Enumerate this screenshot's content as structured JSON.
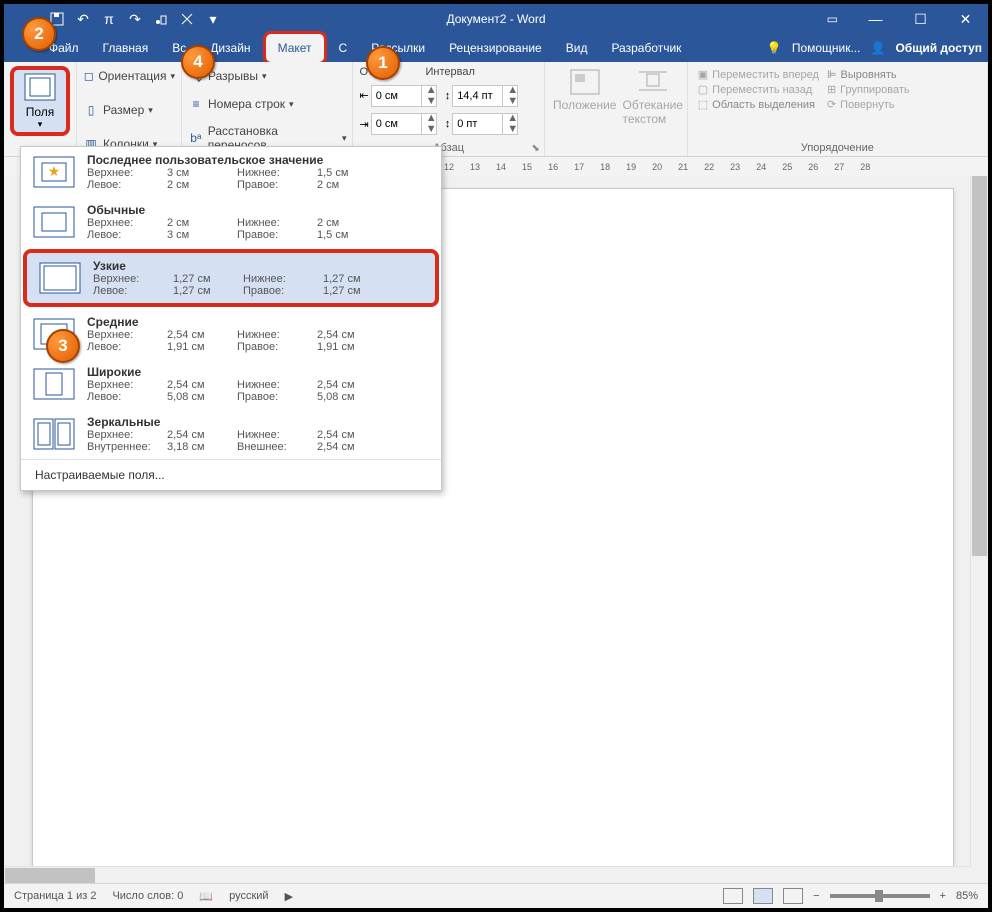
{
  "title": "Документ2 - Word",
  "qat": {
    "arrow": "▾"
  },
  "win": {
    "min": "—",
    "max": "☐",
    "close": "✕"
  },
  "tabs": [
    "Файл",
    "Главная",
    "Вс",
    "Дизайн",
    "Макет",
    "С",
    "Рассылки",
    "Рецензирование",
    "Вид",
    "Разработчик"
  ],
  "activeTab": 4,
  "help": "Помощник...",
  "share": "Общий доступ",
  "ribbon": {
    "margins_btn": "Поля",
    "orient": "Ориентация",
    "size": "Размер",
    "columns": "Колонки",
    "breaks": "Разрывы",
    "lines": "Номера строк",
    "hyphen": "Расстановка переносов",
    "indent_lbl": "Отступ",
    "spacing_lbl": "Интервал",
    "indL": "0 см",
    "indR": "0 см",
    "spB": "14,4 пт",
    "spA": "0 пт",
    "paragraph": "Абзац",
    "position": "Положение",
    "wrap": "Обтекание текстом",
    "fwd": "Переместить вперед",
    "back": "Переместить назад",
    "pane": "Область выделения",
    "align": "Выровнять",
    "group": "Группировать",
    "rotate": "Повернуть",
    "arrange": "Упорядочение"
  },
  "ruler": [
    "12",
    "13",
    "14",
    "15",
    "16",
    "17",
    "18",
    "19",
    "20",
    "21",
    "22",
    "23",
    "24",
    "25",
    "26",
    "27",
    "28"
  ],
  "margins": {
    "last": {
      "t": "Последнее пользовательское значение",
      "top": "Верхнее:",
      "left": "Левое:",
      "bot": "Нижнее:",
      "right": "Правое:",
      "tv": "3 см",
      "lv": "2 см",
      "bv": "1,5 см",
      "rv": "2 см"
    },
    "normal": {
      "t": "Обычные",
      "tv": "2 см",
      "lv": "3 см",
      "bv": "2 см",
      "rv": "1,5 см"
    },
    "narrow": {
      "t": "Узкие",
      "tv": "1,27 см",
      "lv": "1,27 см",
      "bv": "1,27 см",
      "rv": "1,27 см"
    },
    "medium": {
      "t": "Средние",
      "tv": "2,54 см",
      "lv": "1,91 см",
      "bv": "2,54 см",
      "rv": "1,91 см"
    },
    "wide": {
      "t": "Широкие",
      "tv": "2,54 см",
      "lv": "5,08 см",
      "bv": "2,54 см",
      "rv": "5,08 см"
    },
    "mirror": {
      "t": "Зеркальные",
      "top": "Верхнее:",
      "inner": "Внутреннее:",
      "bot": "Нижнее:",
      "outer": "Внешнее:",
      "tv": "2,54 см",
      "lv": "3,18 см",
      "bv": "2,54 см",
      "rv": "2,54 см"
    },
    "custom": "Настраиваемые поля..."
  },
  "status": {
    "page": "Страница 1 из 2",
    "words": "Число слов: 0",
    "lang": "русский",
    "zoom": "85%"
  }
}
